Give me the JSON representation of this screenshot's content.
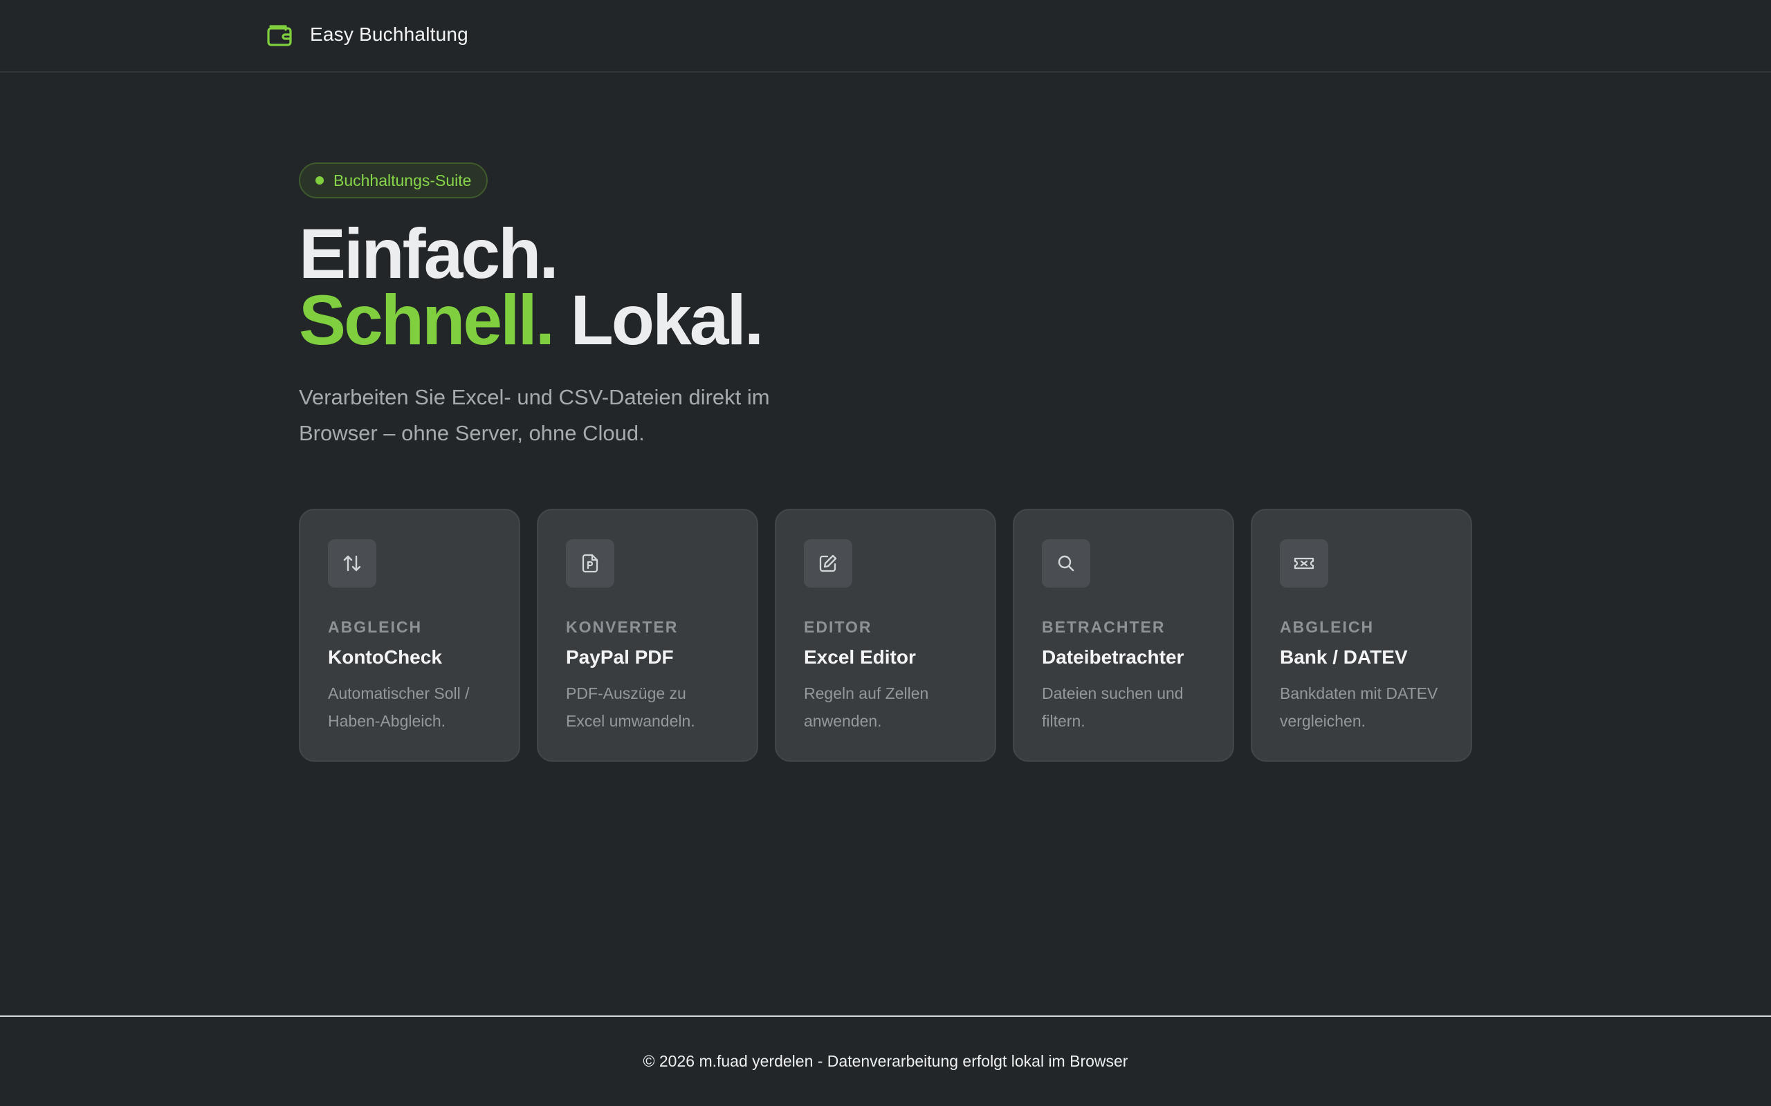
{
  "header": {
    "brand_name": "Easy Buchhaltung",
    "brand_icon": "wallet-icon"
  },
  "hero": {
    "badge": "Buchhaltungs-Suite",
    "headline_line1": "Einfach.",
    "headline_accent": "Schnell.",
    "headline_rest": " Lokal.",
    "subtitle": "Verarbeiten Sie Excel- und CSV-Dateien direkt im Browser – ohne Server, ohne Cloud."
  },
  "cards": [
    {
      "icon": "arrows-up-down-icon",
      "category": "ABGLEICH",
      "title": "KontoCheck",
      "desc": "Automatischer Soll / Haben-Abgleich."
    },
    {
      "icon": "pdf-file-icon",
      "category": "KONVERTER",
      "title": "PayPal PDF",
      "desc": "PDF-Auszüge zu Excel umwandeln."
    },
    {
      "icon": "edit-icon",
      "category": "EDITOR",
      "title": "Excel Editor",
      "desc": "Regeln auf Zellen anwenden."
    },
    {
      "icon": "search-icon",
      "category": "BETRACHTER",
      "title": "Dateibetrachter",
      "desc": "Dateien suchen und filtern."
    },
    {
      "icon": "ticket-icon",
      "category": "ABGLEICH",
      "title": "Bank / DATEV",
      "desc": "Bankdaten mit DATEV vergleichen."
    }
  ],
  "footer": {
    "text": "© 2026 m.fuad yerdelen - Datenverarbeitung erfolgt lokal im Browser"
  },
  "colors": {
    "background": "#222629",
    "accent": "#7fcf3f",
    "card": "#393d40"
  }
}
